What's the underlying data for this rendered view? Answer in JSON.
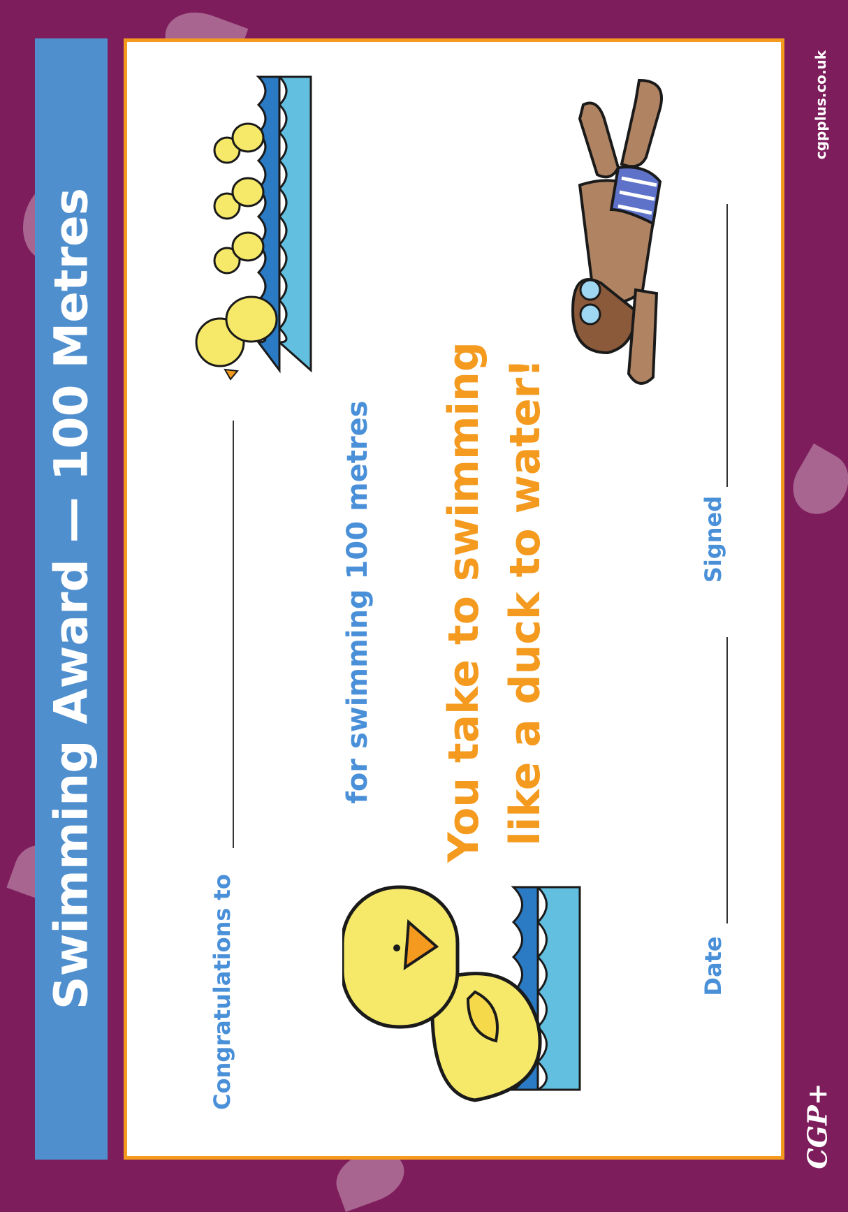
{
  "banner": {
    "title": "Swimming Award — 100 Metres"
  },
  "certificate": {
    "congratulations_label": "Congratulations to",
    "achievement_text": "for swimming 100 metres",
    "tagline_line1": "You take to swimming",
    "tagline_line2": "like a duck to water!",
    "date_label": "Date",
    "signed_label": "Signed"
  },
  "footer": {
    "website": "cgpplus.co.uk",
    "logo_text": "CGP+"
  },
  "colors": {
    "background": "#7e1d5c",
    "banner": "#4f8fce",
    "border": "#f39a1f",
    "label_blue": "#4a90d9",
    "tagline_orange": "#f39a1f"
  }
}
